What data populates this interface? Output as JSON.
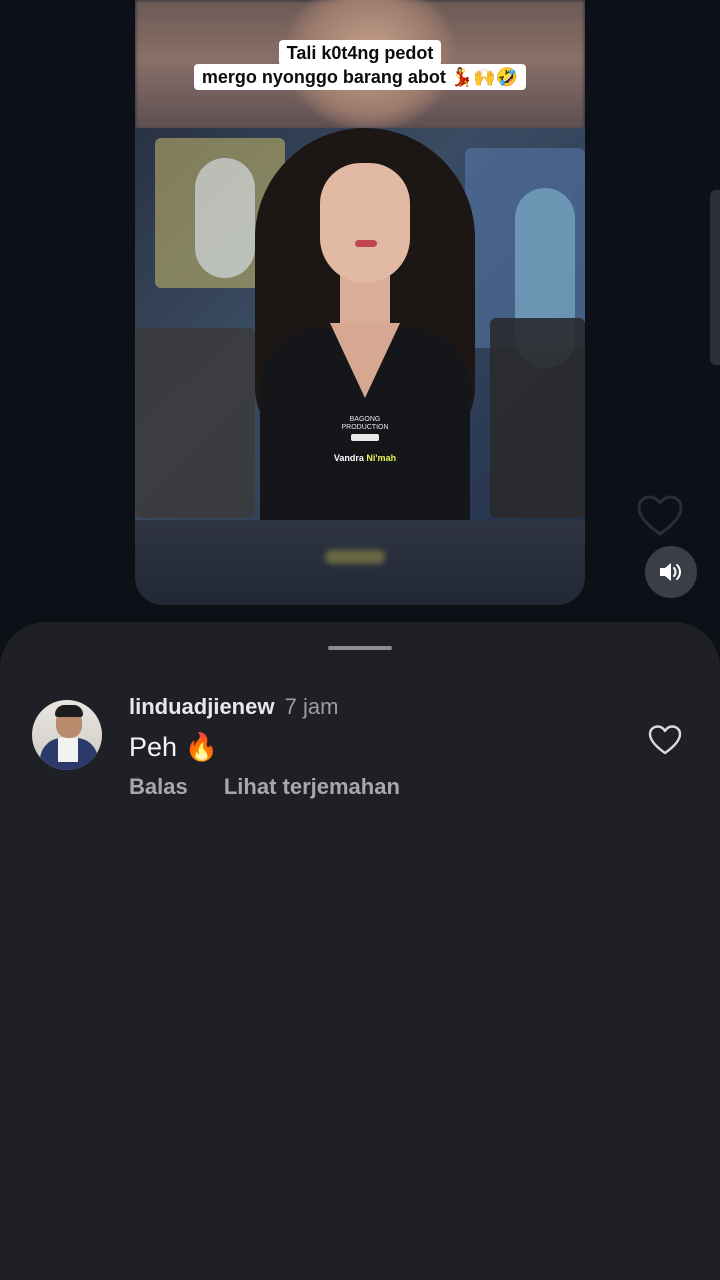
{
  "video": {
    "caption_line1": "Tali k0t4ng pedot",
    "caption_line2": "mergo nyonggo barang abot 💃🙌🤣",
    "watermark_line1": "BAGONG",
    "watermark_line2": "PRODUCTION",
    "artist_name_part1": "Vandra ",
    "artist_name_part2": "Ni'mah"
  },
  "side_actions": {
    "like_icon": "heart-outline-icon",
    "volume_icon": "speaker-volume-icon"
  },
  "comments": [
    {
      "username": "linduadjienew",
      "time": "7 jam",
      "text": "Peh 🔥",
      "reply_label": "Balas",
      "translate_label": "Lihat terjemahan",
      "avatar": "avatar",
      "like_icon": "heart-outline-icon"
    }
  ],
  "colors": {
    "background": "#0d1117",
    "sheet": "#1f2026",
    "username": "#e7e8ea",
    "muted": "#9a9ca2",
    "artist_highlight": "#e9f25a"
  }
}
